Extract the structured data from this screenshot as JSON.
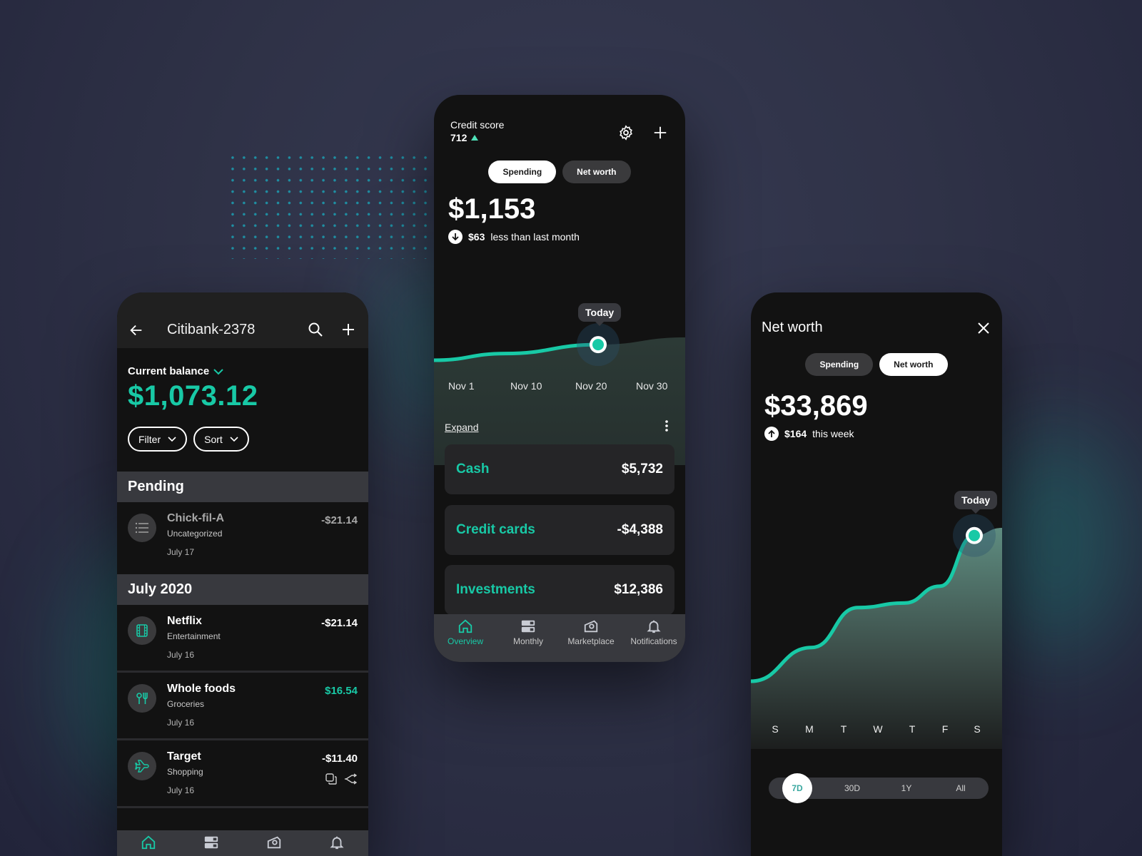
{
  "colors": {
    "accent": "#18c9a6",
    "phone_bg": "#121212",
    "surface": "#38393e",
    "card": "#252527"
  },
  "left_phone": {
    "header": {
      "title": "Citibank-2378",
      "back_icon": "arrow-left-icon",
      "search_icon": "search-icon",
      "add_icon": "plus-icon"
    },
    "balance": {
      "label": "Current balance",
      "amount": "$1,073.12"
    },
    "filters": [
      {
        "label": "Filter"
      },
      {
        "label": "Sort"
      }
    ],
    "sections": [
      {
        "title": "Pending",
        "transactions": [
          {
            "name": "Chick-fil-A",
            "category": "Uncategorized",
            "date": "July 17",
            "amount": "-$21.14",
            "icon": "list-icon"
          }
        ]
      },
      {
        "title": "July 2020",
        "transactions": [
          {
            "name": "Netflix",
            "category": "Entertainment",
            "date": "July 16",
            "amount": "-$21.14",
            "icon": "film-icon"
          },
          {
            "name": "Whole foods",
            "category": "Groceries",
            "date": "July 16",
            "amount": "$16.54",
            "icon": "utensils-icon"
          },
          {
            "name": "Target",
            "category": "Shopping",
            "date": "July 16",
            "amount": "-$11.40",
            "icon": "airplane-icon"
          }
        ]
      }
    ]
  },
  "mid_phone": {
    "credit_score": {
      "label": "Credit score",
      "value": "712"
    },
    "segments": [
      {
        "label": "Spending",
        "active": true
      },
      {
        "label": "Net worth",
        "active": false
      }
    ],
    "amount": "$1,153",
    "delta": {
      "value": "$63",
      "text": "less than last month",
      "direction": "down"
    },
    "chart_data": {
      "type": "area",
      "x": [
        "Nov 1",
        "Nov 10",
        "Nov 20",
        "Nov 30"
      ],
      "series": [
        {
          "name": "Spending",
          "values": [
            0.18,
            0.42,
            0.74,
            1.0
          ]
        }
      ],
      "highlight": {
        "label": "Today",
        "x": "Nov 20"
      }
    },
    "expand_label": "Expand",
    "accounts": [
      {
        "label": "Cash",
        "value": "$5,732"
      },
      {
        "label": "Credit cards",
        "value": "-$4,388"
      },
      {
        "label": "Investments",
        "value": "$12,386"
      }
    ],
    "nav": [
      {
        "label": "Overview",
        "icon": "home-icon",
        "active": true
      },
      {
        "label": "Monthly",
        "icon": "monthly-icon",
        "active": false
      },
      {
        "label": "Marketplace",
        "icon": "marketplace-icon",
        "active": false
      },
      {
        "label": "Notifications",
        "icon": "bell-icon",
        "active": false
      }
    ]
  },
  "right_phone": {
    "title": "Net worth",
    "segments": [
      {
        "label": "Spending",
        "active": false
      },
      {
        "label": "Net worth",
        "active": true
      }
    ],
    "amount": "$33,869",
    "delta": {
      "value": "$164",
      "text": "this week",
      "direction": "up"
    },
    "chart_data": {
      "type": "area",
      "x": [
        "S",
        "M",
        "T",
        "W",
        "T",
        "F",
        "S"
      ],
      "series": [
        {
          "name": "Net worth",
          "values": [
            0.0,
            0.22,
            0.48,
            0.51,
            0.62,
            0.95,
            1.0
          ]
        }
      ],
      "highlight": {
        "label": "Today",
        "x": "S"
      }
    },
    "ranges": [
      {
        "label": "7D",
        "active": true
      },
      {
        "label": "30D",
        "active": false
      },
      {
        "label": "1Y",
        "active": false
      },
      {
        "label": "All",
        "active": false
      }
    ]
  }
}
